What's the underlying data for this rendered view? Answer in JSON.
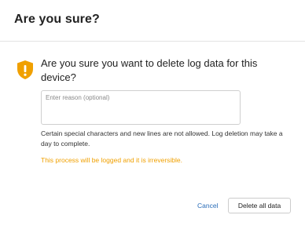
{
  "dialog": {
    "title": "Are you sure?",
    "icon": "shield-warning-icon",
    "question": "Are you sure you want to delete log data for this device?",
    "reason": {
      "value": "",
      "placeholder": "Enter reason (optional)"
    },
    "hint": "Certain special characters and new lines are not allowed. Log deletion may take a day to complete.",
    "warning_note": "This process will be logged and it is irreversible.",
    "cancel_label": "Cancel",
    "delete_label": "Delete all data"
  },
  "colors": {
    "warning": "#f0a000",
    "link": "#2a6db8"
  }
}
